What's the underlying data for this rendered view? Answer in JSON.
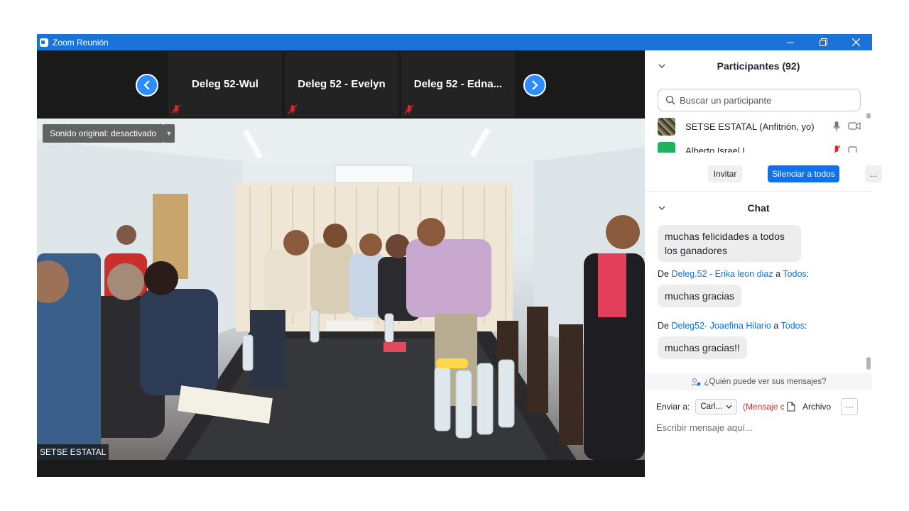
{
  "window": {
    "title": "Zoom Reunión"
  },
  "gallery_strip": {
    "tiles": [
      {
        "name": "Deleg 52-Wul"
      },
      {
        "name": "Deleg 52 - Evelyn"
      },
      {
        "name": "Deleg 52 - Edna..."
      }
    ]
  },
  "main_video": {
    "sound_label": "Sonido original: desactivado",
    "speaker_name": "SETSE ESTATAL"
  },
  "participants": {
    "header": "Participantes (92)",
    "search_placeholder": "Buscar un participante",
    "rows": [
      {
        "name": "SETSE ESTATAL (Anfitrión, yo)"
      },
      {
        "name": "Alberto Israel I..."
      }
    ],
    "invite_label": "Invitar",
    "mute_all_label": "Silenciar a todos",
    "more_label": "..."
  },
  "chat": {
    "header": "Chat",
    "messages": [
      {
        "text": "muchas felicidades a todos los ganadores"
      },
      {
        "from_prefix": "De",
        "sender": "Deleg.52 - Erika leon diaz",
        "to_word": "a",
        "recipient": "Todos",
        "text": "muchas gracias"
      },
      {
        "from_prefix": "De",
        "sender": "Deleg52- Joaefina Hilario",
        "to_word": "a",
        "recipient": "Todos",
        "text": "muchas gracias!!"
      }
    ],
    "who_can_see": "¿Quién puede ver sus mensajes?",
    "send_to_label": "Enviar a:",
    "send_to_value": "Carl...",
    "mode_text": "(Mensaje c",
    "file_label": "Archivo",
    "more_label": "···",
    "input_placeholder": "Escribir mensaje aquí..."
  },
  "colors": {
    "titlebar": "#1a73d9",
    "accent": "#0e72ed",
    "link": "#0e72ed",
    "muted_red": "#e02828"
  }
}
